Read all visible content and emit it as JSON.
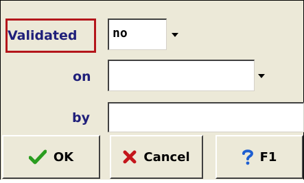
{
  "form": {
    "validated_label": "Validated",
    "validated_value": "no",
    "on_label": "on",
    "on_value": "",
    "by_label": "by",
    "by_value": ""
  },
  "buttons": {
    "ok_label": "OK",
    "cancel_label": "Cancel",
    "help_label": "F1"
  },
  "icons": {
    "ok": "check-icon",
    "cancel": "x-icon",
    "help": "question-icon"
  },
  "colors": {
    "label_text": "#1f1f7a",
    "highlight": "#b4161b",
    "dialog_bg": "#ece9d8",
    "ok_icon": "#2a9d1f",
    "cancel_icon": "#c4161c",
    "help_icon": "#1f5fd1"
  }
}
